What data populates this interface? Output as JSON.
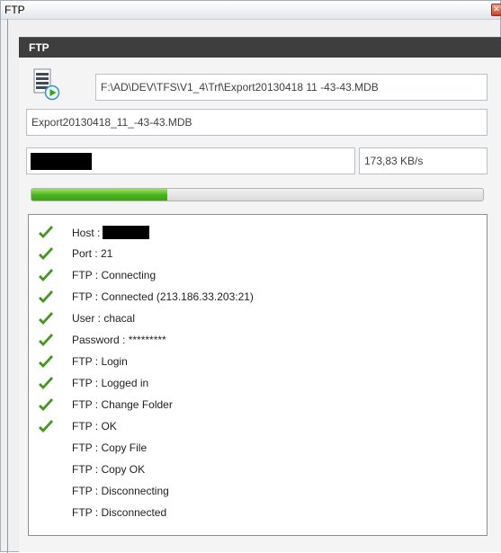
{
  "window": {
    "title": "FTP",
    "close_icon": "close-icon",
    "close_color": "#c7442b"
  },
  "panel": {
    "header": "FTP",
    "file_icon": "file-transfer-icon",
    "remote_path": "F:\\AD\\DEV\\TFS\\V1_4\\Trf\\Export20130418 11 -43-43.MDB",
    "file_name": "Export20130418_11_-43-43.MDB",
    "speed": "173,83 KB/s",
    "progress_fraction": 0.3,
    "progress_color": "#47b31e"
  },
  "log": {
    "entries": [
      {
        "text": "Host :",
        "done": true,
        "redacted": true
      },
      {
        "text": "Port : 21",
        "done": true
      },
      {
        "text": "FTP : Connecting",
        "done": true
      },
      {
        "text": "FTP : Connected (213.186.33.203:21)",
        "done": true
      },
      {
        "text": "User : chacal",
        "done": true
      },
      {
        "text": "Password : *********",
        "done": true
      },
      {
        "text": "FTP : Login",
        "done": true
      },
      {
        "text": "FTP : Logged in",
        "done": true
      },
      {
        "text": "FTP : Change Folder",
        "done": true
      },
      {
        "text": "FTP : OK",
        "done": true
      },
      {
        "text": "FTP : Copy File",
        "done": false
      },
      {
        "text": "FTP : Copy OK",
        "done": false
      },
      {
        "text": "FTP : Disconnecting",
        "done": false
      },
      {
        "text": "FTP : Disconnected",
        "done": false
      }
    ],
    "check_icon": "checkmark-icon",
    "check_color": "#3f9a1c"
  }
}
